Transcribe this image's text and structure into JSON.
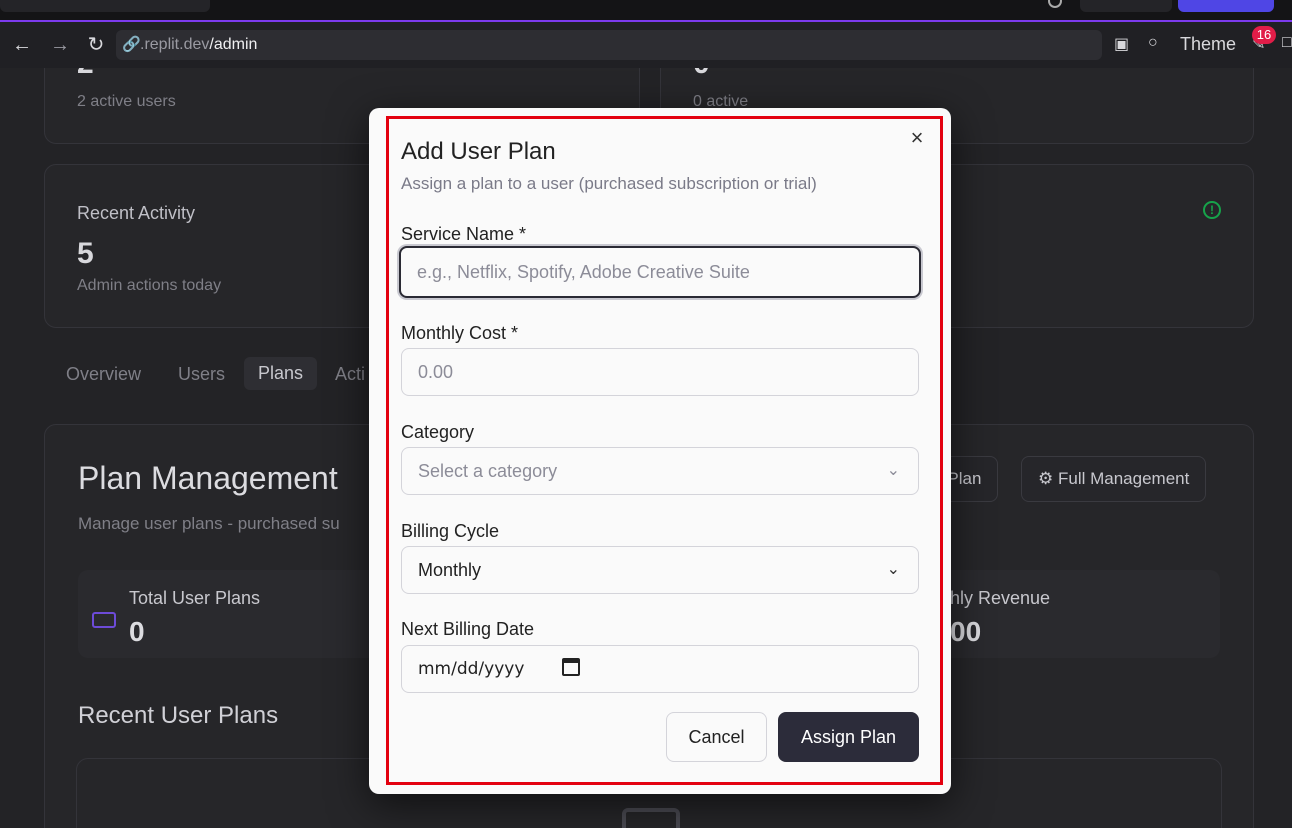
{
  "browser": {
    "url_domain": ".replit.dev",
    "url_path": "/admin",
    "theme_label": "Theme",
    "notification_count": "16"
  },
  "background": {
    "stat1_value": "2",
    "stat1_sub": "2 active users",
    "stat2_value": "0",
    "stat2_sub": "0 active",
    "activity_title": "Recent Activity",
    "activity_value": "5",
    "activity_sub": "Admin actions today",
    "tabs": [
      {
        "label": "Overview"
      },
      {
        "label": "Users"
      },
      {
        "label": "Plans"
      },
      {
        "label": "Acti"
      }
    ],
    "plan_title": "Plan Management",
    "plan_sub": "Manage user plans - purchased su",
    "btn_partial": "r Plan",
    "btn_full": "Full Management",
    "total_label": "Total User Plans",
    "total_value": "0",
    "revenue_label": "hly Revenue",
    "revenue_value": "00",
    "recent_plans": "Recent User Plans"
  },
  "modal": {
    "title": "Add User Plan",
    "description": "Assign a plan to a user (purchased subscription or trial)",
    "service_label": "Service Name *",
    "service_placeholder": "e.g., Netflix, Spotify, Adobe Creative Suite",
    "cost_label": "Monthly Cost *",
    "cost_placeholder": "0.00",
    "category_label": "Category",
    "category_value": "Select a category",
    "billing_label": "Billing Cycle",
    "billing_value": "Monthly",
    "date_label": "Next Billing Date",
    "date_placeholder": "mm/dd/yyyy",
    "cancel_label": "Cancel",
    "assign_label": "Assign Plan"
  },
  "colors": {
    "accent": "#7c3aed",
    "outline": "#e3000f",
    "primary_button": "#2c2c3a"
  }
}
